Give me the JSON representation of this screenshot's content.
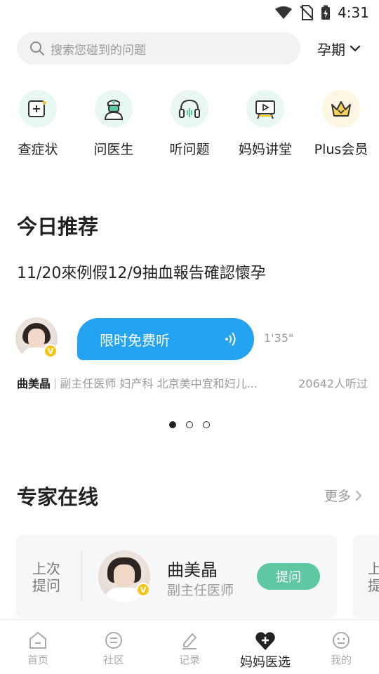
{
  "status_bar": {
    "time": "4:31"
  },
  "search": {
    "placeholder": "搜索您碰到的问题",
    "stage_label": "孕期"
  },
  "quick_actions": [
    {
      "label": "查症状",
      "icon": "symptom-check-icon"
    },
    {
      "label": "问医生",
      "icon": "doctor-icon"
    },
    {
      "label": "听问题",
      "icon": "headphones-icon"
    },
    {
      "label": "妈妈讲堂",
      "icon": "video-lecture-icon"
    },
    {
      "label": "Plus会员",
      "icon": "crown-icon"
    }
  ],
  "today": {
    "section_title": "今日推荐",
    "question": "11/20來例假12/9抽血報告確認懷孕",
    "play_label": "限时免费听",
    "duration": "1'35\"",
    "doctor_name": "曲美晶",
    "doctor_info": "副主任医师 妇产科 北京美中宜和妇儿...",
    "listeners": "20642人听过",
    "carousel_pages": 3,
    "carousel_active": 1
  },
  "experts": {
    "section_title": "专家在线",
    "more_label": "更多",
    "cards": [
      {
        "last_ask_label": "上次提问",
        "name": "曲美晶",
        "title": "副主任医师",
        "ask_label": "提问"
      }
    ],
    "peek_text": "上提"
  },
  "tabs": [
    {
      "label": "首页",
      "icon": "home-icon",
      "active": false
    },
    {
      "label": "社区",
      "icon": "community-icon",
      "active": false
    },
    {
      "label": "记录",
      "icon": "edit-record-icon",
      "active": false
    },
    {
      "label": "妈妈医选",
      "icon": "heart-plus-icon",
      "active": true
    },
    {
      "label": "我的",
      "icon": "profile-icon",
      "active": false
    }
  ],
  "colors": {
    "accent_green": "#5ec8a3",
    "play_blue": "#24a3f0",
    "icon_bg": "#e9f7f2",
    "badge_gold": "#f5c518"
  }
}
